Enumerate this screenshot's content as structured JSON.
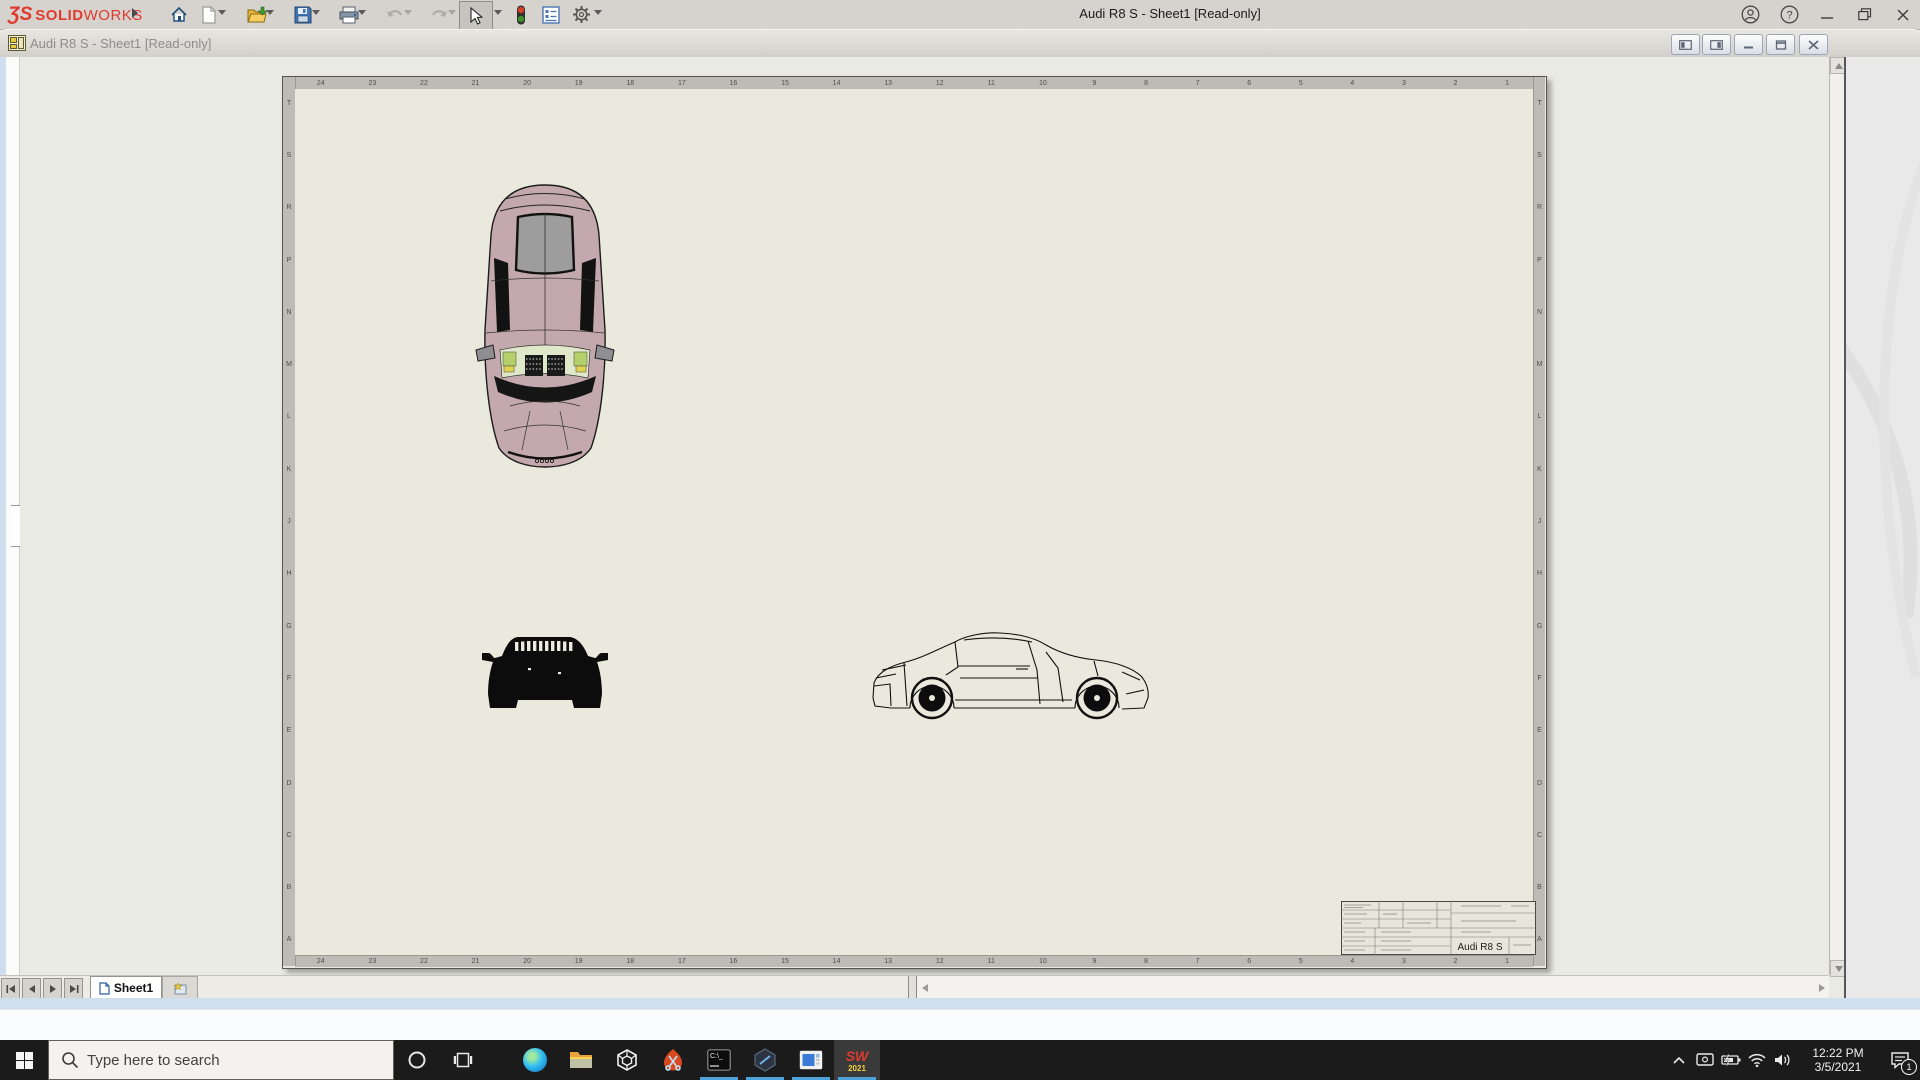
{
  "titlebar": {
    "title": "Audi R8 S - Sheet1 [Read-only]",
    "brand": {
      "mark": "ƷS",
      "bold": "SOLID",
      "rest": "WORKS",
      "color": "#e03a2f"
    },
    "tools": [
      "home",
      "new-document",
      "open",
      "save",
      "print",
      "undo",
      "redo",
      "select-cursor",
      "display-states",
      "file-properties",
      "options-gear"
    ]
  },
  "docwindow": {
    "title": "Audi R8 S - Sheet1 [Read-only]"
  },
  "sheet": {
    "zone_numbers": [
      "24",
      "23",
      "22",
      "21",
      "20",
      "19",
      "18",
      "17",
      "16",
      "15",
      "14",
      "13",
      "12",
      "11",
      "10",
      "9",
      "8",
      "7",
      "6",
      "5",
      "4",
      "3",
      "2",
      "1"
    ],
    "zone_letters": [
      "T",
      "S",
      "R",
      "P",
      "N",
      "M",
      "L",
      "K",
      "J",
      "H",
      "G",
      "F",
      "E",
      "D",
      "C",
      "B",
      "A"
    ],
    "title_block_title": "Audi R8 S",
    "views": [
      "top-view-shaded",
      "front-view-silhouette",
      "side-view-wireframe"
    ]
  },
  "bottombar": {
    "sheet_tab": "Sheet1"
  },
  "taskbar": {
    "search_placeholder": "Type here to search",
    "time": "12:22 PM",
    "date": "3/5/2021",
    "badge": "1",
    "apps": [
      "edge",
      "file-explorer",
      "3d-viewer",
      "snip",
      "command-prompt",
      "hexagon-app",
      "window-app",
      "solidworks-2021"
    ]
  }
}
